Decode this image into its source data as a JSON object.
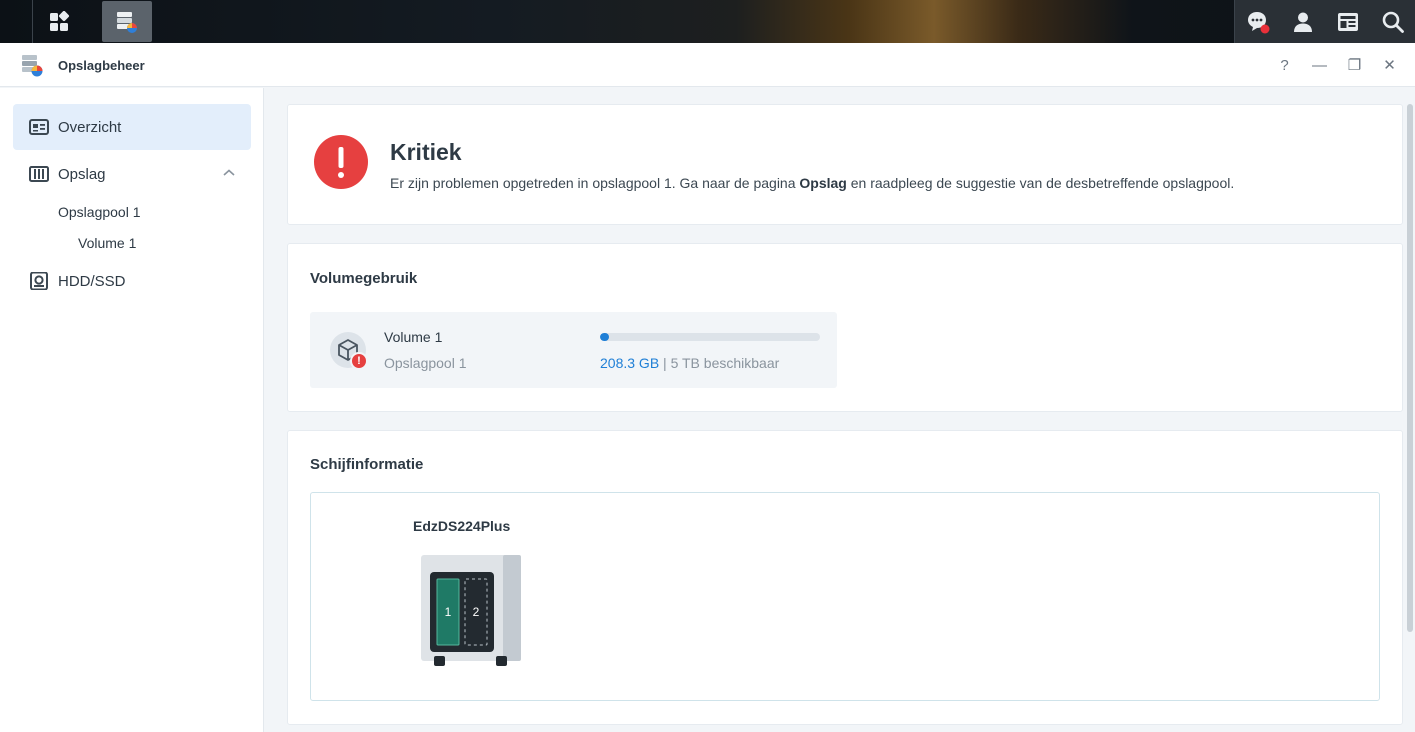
{
  "taskbar": {
    "left_buttons": [
      {
        "name": "main-menu",
        "icon": "grid-icon"
      },
      {
        "name": "storage-manager",
        "icon": "storage-manager-icon"
      }
    ],
    "right_buttons": [
      {
        "name": "notifications",
        "icon": "chat-notification-icon",
        "badge_color": "#e64040"
      },
      {
        "name": "user",
        "icon": "user-icon"
      },
      {
        "name": "widgets",
        "icon": "widgets-icon"
      },
      {
        "name": "search",
        "icon": "search-icon"
      }
    ]
  },
  "window": {
    "title": "Opslagbeheer",
    "controls": {
      "help": "?",
      "minimize": "—",
      "restore": "❐",
      "close": "✕"
    }
  },
  "sidebar": {
    "items": [
      {
        "label": "Overzicht",
        "icon": "overview-icon",
        "active": true
      },
      {
        "label": "Opslag",
        "icon": "storage-icon",
        "expanded": true
      },
      {
        "label": "HDD/SSD",
        "icon": "disk-icon"
      }
    ],
    "sub_items": {
      "pool": "Opslagpool 1",
      "volume": "Volume 1"
    }
  },
  "alert": {
    "title": "Kritiek",
    "message_before": "Er zijn problemen opgetreden in opslagpool 1. Ga naar de pagina ",
    "message_bold": "Opslag",
    "message_after": " en raadpleeg de suggestie van de desbetreffende opslagpool.",
    "color": "#e64040"
  },
  "volume_usage": {
    "title": "Volumegebruik",
    "volume_name": "Volume 1",
    "pool_name": "Opslagpool 1",
    "used": "208.3 GB",
    "separator": " | ",
    "available": "5 TB beschikbaar",
    "used_fraction": 0.04,
    "bar_color": "#1f7fd6"
  },
  "disk_info": {
    "title": "Schijfinformatie",
    "device_name": "EdzDS224Plus",
    "bays": [
      {
        "label": "1",
        "state": "installed",
        "color": "#1f7a66"
      },
      {
        "label": "2",
        "state": "empty"
      }
    ]
  }
}
